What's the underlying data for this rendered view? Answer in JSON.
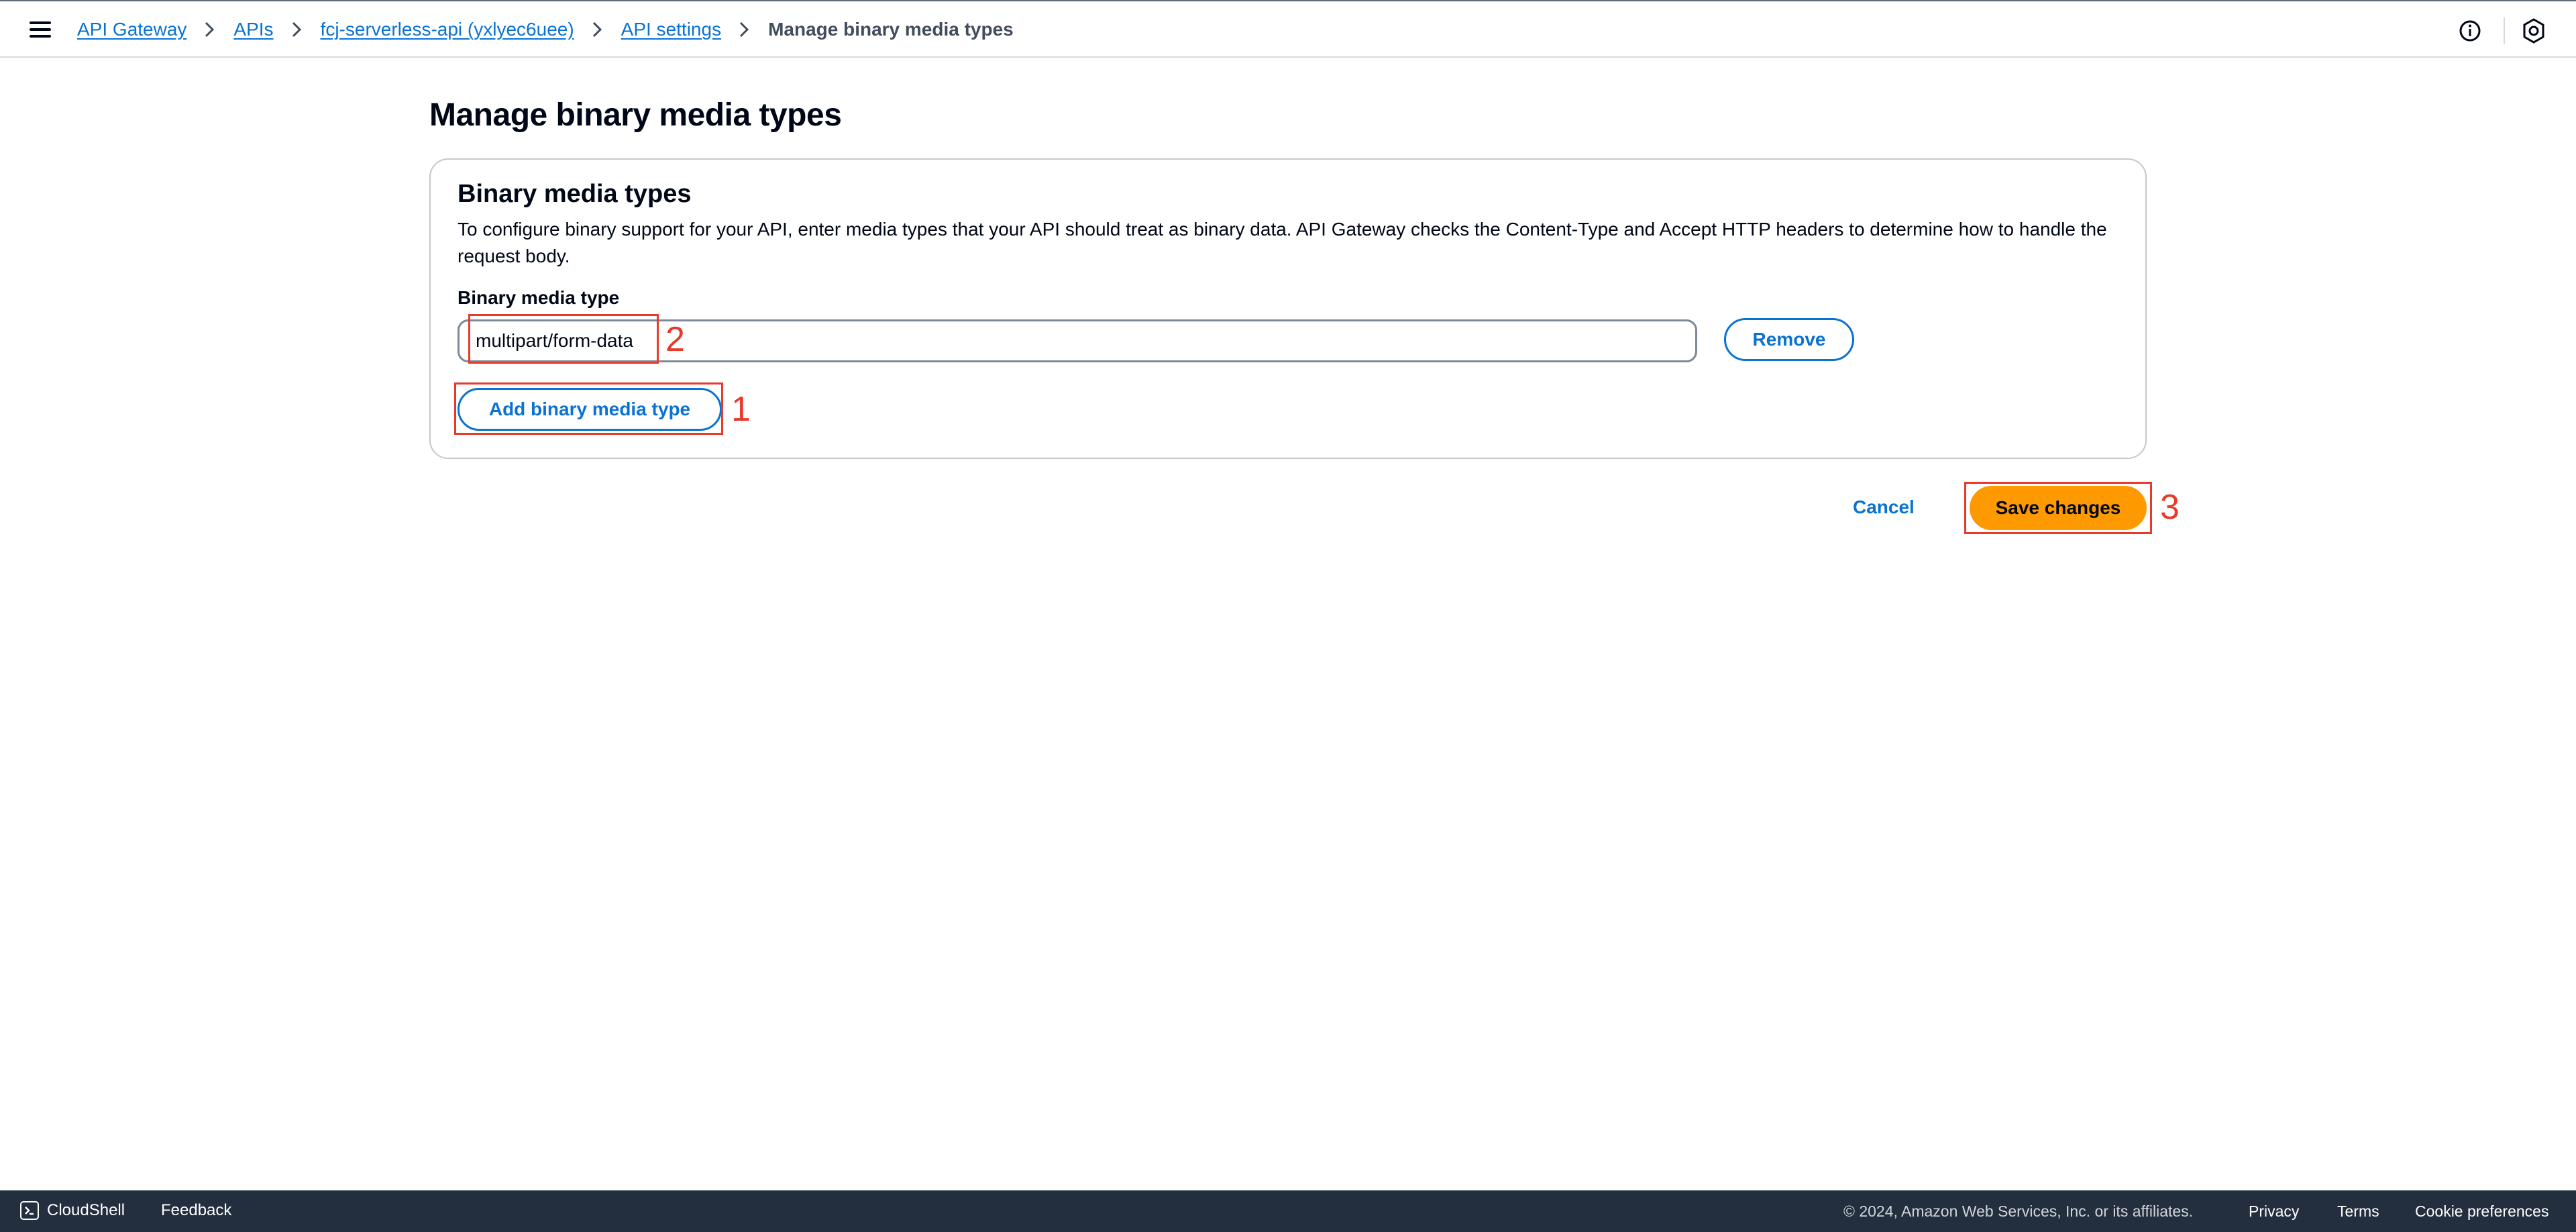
{
  "breadcrumbs": [
    {
      "label": "API Gateway"
    },
    {
      "label": "APIs"
    },
    {
      "label": "fcj-serverless-api (yxlyec6uee)"
    },
    {
      "label": "API settings"
    }
  ],
  "breadcrumb_current": "Manage binary media types",
  "icons": {
    "menu": "hamburger-menu-icon",
    "info": "info-icon",
    "settings": "settings-icon",
    "breadcrumb_separator": "chevron-right-icon",
    "cloudshell": "cloudshell-icon"
  },
  "page": {
    "title": "Manage binary media types"
  },
  "container": {
    "title": "Binary media types",
    "description": "To configure binary support for your API, enter media types that your API should treat as binary data. API Gateway checks the Content-Type and Accept HTTP headers to determine how to handle the request body.",
    "field_label": "Binary media type",
    "field_value": "multipart/form-data",
    "remove_label": "Remove",
    "add_label": "Add binary media type"
  },
  "actions": {
    "cancel_label": "Cancel",
    "save_label": "Save changes"
  },
  "annotations": {
    "add_button_number": "1",
    "input_number": "2",
    "save_button_number": "3",
    "color": "#e8392a"
  },
  "footer": {
    "cloudshell_label": "CloudShell",
    "feedback_label": "Feedback",
    "copyright": "© 2024, Amazon Web Services, Inc. or its affiliates.",
    "privacy_label": "Privacy",
    "terms_label": "Terms",
    "cookie_label": "Cookie preferences"
  },
  "colors": {
    "link": "#0972d3",
    "primary_button": "#ff9900",
    "footer_bg": "#232f3e",
    "text": "#000716"
  }
}
